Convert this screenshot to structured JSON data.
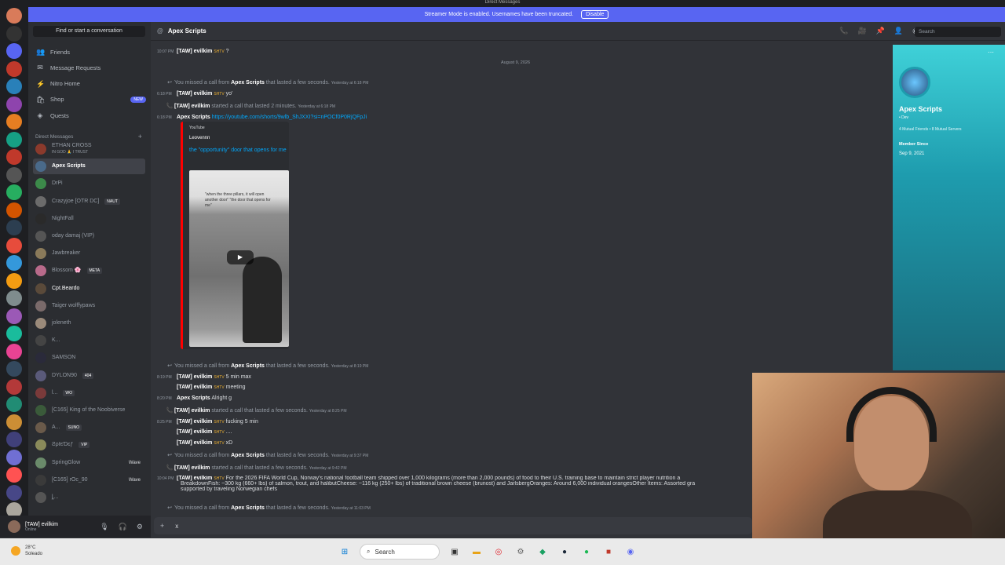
{
  "window": {
    "title": "Direct Messages"
  },
  "banner": {
    "text": "Streamer Mode is enabled. Usernames have been truncated.",
    "button": "Disable"
  },
  "dm_sidebar": {
    "find_placeholder": "Find or start a conversation",
    "nav": [
      {
        "label": "Friends",
        "icon": "friends-icon"
      },
      {
        "label": "Message Requests",
        "icon": "mail-icon"
      },
      {
        "label": "Nitro Home",
        "icon": "nitro-icon"
      },
      {
        "label": "Shop",
        "icon": "shop-icon",
        "badge": "NEW"
      },
      {
        "label": "Quests",
        "icon": "quests-icon"
      }
    ],
    "section_label": "Direct Messages",
    "dms": [
      {
        "name": "ETHAN CROSS",
        "sub": "IN GOD 🙏 I TRUST",
        "color": "#8b3a2c"
      },
      {
        "name": "Apex Scripts",
        "color": "#4a6a8a",
        "active": true
      },
      {
        "name": "DrPi",
        "color": "#3c8a4a"
      },
      {
        "name": "Crazyjoe [OTR DC]",
        "tag": "NAUT",
        "color": "#6b6b6b"
      },
      {
        "name": "NightFall",
        "color": "#2a2a2a"
      },
      {
        "name": "oday damaj (VIP)",
        "color": "#555"
      },
      {
        "name": "Jawbreaker",
        "color": "#8a7a5a"
      },
      {
        "name": "Blossom 🌸",
        "tag": "META",
        "color": "#b86a8a"
      },
      {
        "name": "Cpt.Beardo",
        "color": "#5a4a3a",
        "bold": true
      },
      {
        "name": "Taiger wolffypaws",
        "color": "#7a6a6a"
      },
      {
        "name": "joleneth",
        "color": "#9a8a7a"
      },
      {
        "name": "K...",
        "color": "#444"
      },
      {
        "name": "SAMSON",
        "color": "#2a2a3a"
      },
      {
        "name": "DYLON90",
        "tag": "404",
        "color": "#5a5a7a"
      },
      {
        "name": "l...",
        "tag": "WO",
        "color": "#7a3a3a"
      },
      {
        "name": "[C165] King of the Noobiverse",
        "color": "#3a5a3a"
      },
      {
        "name": "A...",
        "tag": "SUNO",
        "color": "#6a5a4a"
      },
      {
        "name": "ƧρℓєƊɛƒ",
        "tag": "VIP",
        "color": "#8a8a5a"
      },
      {
        "name": "SpringGlow",
        "wave": "Wave",
        "color": "#6a8a6a"
      },
      {
        "name": "[C165] rOc_90",
        "wave": "Wave",
        "color": "#3a3a3a"
      },
      {
        "name": "ȴ...",
        "color": "#555"
      }
    ]
  },
  "user_panel": {
    "name": "[TAW] evilkim",
    "status": "Online"
  },
  "chat": {
    "title": "Apex Scripts",
    "search_placeholder": "Search",
    "date_divider": "August 9, 2026",
    "messages": [
      {
        "ts": "10:07 PM",
        "user": "[TAW] evilkim",
        "badge": "SHTV",
        "text": "?"
      },
      {
        "type": "call",
        "text_a": "You missed a call from",
        "user": "Apex Scripts",
        "text_b": "that lasted a few seconds.",
        "when": "Yesterday at 6:18 PM"
      },
      {
        "ts": "6:18 PM",
        "user": "[TAW] evilkim",
        "badge": "SHTV",
        "text": "yo'"
      },
      {
        "type": "call",
        "green": true,
        "user": "[TAW] evilkim",
        "text_a": "",
        "text_b": "started a call that lasted 2 minutes.",
        "when": "Yesterday at 6:18 PM"
      },
      {
        "ts": "6:18 PM",
        "user": "Apex Scripts",
        "link": "https://youtube.com/shorts/9wlb_ShJXXI?si=nPOCf0P0RjQFpJi"
      },
      {
        "type": "call",
        "text_a": "You missed a call from",
        "user": "Apex Scripts",
        "text_b": "that lasted a few seconds.",
        "when": "Yesterday at 8:19 PM"
      },
      {
        "ts": "8:19 PM",
        "user": "[TAW] evilkim",
        "badge": "SHTV",
        "text": "5 min max"
      },
      {
        "user": "[TAW] evilkim",
        "badge": "SHTV",
        "text": "meeting"
      },
      {
        "ts": "8:20 PM",
        "user": "Apex Scripts",
        "text": "Alright g"
      },
      {
        "type": "call",
        "green": true,
        "user": "[TAW] evilkim",
        "text_a": "",
        "text_b": "started a call that lasted a few seconds.",
        "when": "Yesterday at 8:25 PM"
      },
      {
        "ts": "8:25 PM",
        "user": "[TAW] evilkim",
        "badge": "SHTV",
        "text": "fucking 5 min"
      },
      {
        "user": "[TAW] evilkim",
        "badge": "SHTV",
        "text": "...."
      },
      {
        "user": "[TAW] evilkim",
        "badge": "SHTV",
        "text": "xD"
      },
      {
        "type": "call",
        "text_a": "You missed a call from",
        "user": "Apex Scripts",
        "text_b": "that lasted a few seconds.",
        "when": "Yesterday at 9:37 PM"
      },
      {
        "type": "call",
        "green": true,
        "user": "[TAW] evilkim",
        "text_a": "",
        "text_b": "started a call that lasted a few seconds.",
        "when": "Yesterday at 9:42 PM"
      },
      {
        "ts": "10:04 PM",
        "user": "[TAW] evilkim",
        "badge": "SHTV",
        "text": "For the 2026 FIFA World Cup, Norway's national football team shipped over 1,000 kilograms (more than 2,000 pounds) of food to their U.S. training base to maintain strict player nutrition a",
        "text2": "BreakdownFish: ~300 kg (660+ lbs) of salmon, trout, and halibutCheese: ~116 kg (250+ lbs) of traditional brown cheese (brunost) and JarlsbergOranges: Around 6,000 individual orangesOther Items: Assorted gra",
        "text3": "supported by traveling Norwegian chefs"
      },
      {
        "type": "call",
        "text_a": "You missed a call from",
        "user": "Apex Scripts",
        "text_b": "that lasted a few seconds.",
        "when": "Yesterday at 11:03 PM"
      }
    ],
    "embed": {
      "provider": "YouTube",
      "author": "Leovennn",
      "title": "the \"opportunity\" door that opens for me",
      "caption": "\"when the three pillars, it will open another door\" \"the door that opens for me\""
    },
    "input_value": "x"
  },
  "profile": {
    "name": "Apex Scripts",
    "sub": "• Dev",
    "mutual": "4 Mutual Friends • 8 Mutual Servers",
    "member_since_label": "Member Since",
    "member_since": "Sep 9, 2021"
  },
  "taskbar": {
    "weather_temp": "28°C",
    "weather_desc": "Soleado",
    "search": "Search"
  }
}
